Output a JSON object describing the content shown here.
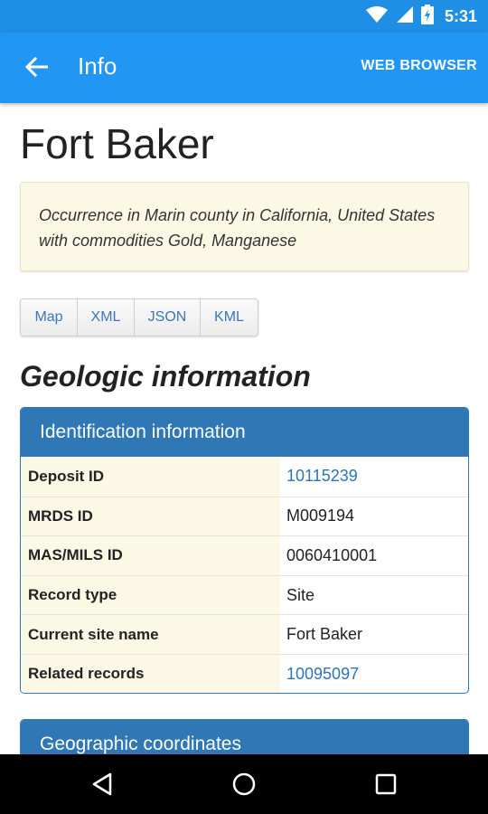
{
  "status_bar": {
    "time": "5:31",
    "icons": [
      "wifi-icon",
      "signal-icon",
      "battery-icon"
    ]
  },
  "app_bar": {
    "title": "Info",
    "action_label": "WEB BROWSER"
  },
  "page": {
    "title": "Fort Baker",
    "description": "Occurrence in Marin county in California, United States with commodities Gold, Manganese",
    "format_buttons": [
      {
        "label": "Map"
      },
      {
        "label": "XML"
      },
      {
        "label": "JSON"
      },
      {
        "label": "KML"
      }
    ],
    "section_heading": "Geologic information"
  },
  "identification_panel": {
    "title": "Identification information",
    "rows": [
      {
        "label": "Deposit ID",
        "value": "10115239",
        "link": true
      },
      {
        "label": "MRDS ID",
        "value": "M009194",
        "link": false
      },
      {
        "label": "MAS/MILS ID",
        "value": "0060410001",
        "link": false
      },
      {
        "label": "Record type",
        "value": "Site",
        "link": false
      },
      {
        "label": "Current site name",
        "value": "Fort Baker",
        "link": false
      },
      {
        "label": "Related records",
        "value": "10095097",
        "link": true
      }
    ]
  },
  "coordinates_panel": {
    "title": "Geographic coordinates"
  },
  "colors": {
    "status_bar": "#1f8fe6",
    "app_bar": "#2196f3",
    "panel_header": "#2f77b5",
    "label_bg": "#fcf8e6",
    "link": "#2d74b8"
  }
}
